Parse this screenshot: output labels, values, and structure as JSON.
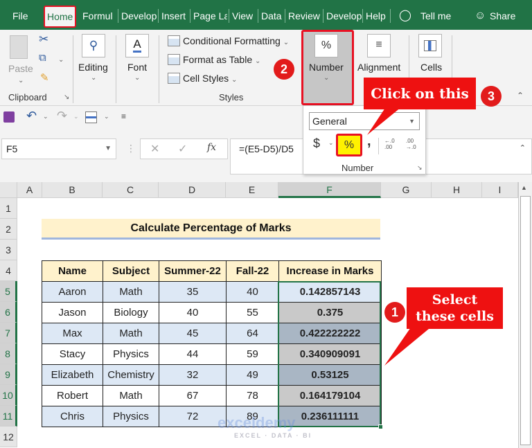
{
  "tabs": {
    "file": "File",
    "home": "Home",
    "formulas": "Formul",
    "developer1": "Develop",
    "insert": "Insert",
    "page_layout": "Page La",
    "view": "View",
    "data": "Data",
    "review": "Review",
    "developer2": "Develop",
    "help": "Help",
    "tell_me": "Tell me",
    "share": "Share"
  },
  "ribbon": {
    "paste": "Paste",
    "clipboard": "Clipboard",
    "editing": "Editing",
    "font": "Font",
    "conditional_formatting": "Conditional Formatting",
    "format_as_table": "Format as Table",
    "cell_styles": "Cell Styles",
    "styles": "Styles",
    "number": "Number",
    "alignment": "Alignment",
    "cells": "Cells",
    "number_glyph": "%"
  },
  "formula_bar": {
    "name_box": "F5",
    "formula": "=(E5-D5)/D5",
    "fx": "fx"
  },
  "number_popup": {
    "format": "General",
    "currency": "$",
    "percent": "%",
    "comma": ",",
    "inc_decimal": "←.0 .00",
    "dec_decimal": ".00 →.0",
    "label": "Number"
  },
  "grid": {
    "columns": [
      "A",
      "B",
      "C",
      "D",
      "E",
      "F",
      "G",
      "H",
      "I"
    ],
    "selected_column": "F",
    "rows": [
      "1",
      "2",
      "3",
      "4",
      "5",
      "6",
      "7",
      "8",
      "9",
      "10",
      "11",
      "12"
    ],
    "title": "Calculate Percentage of Marks",
    "headers": [
      "Name",
      "Subject",
      "Summer-22",
      "Fall-22",
      "Increase in Marks"
    ],
    "data": [
      [
        "Aaron",
        "Math",
        "35",
        "40",
        "0.142857143"
      ],
      [
        "Jason",
        "Biology",
        "40",
        "55",
        "0.375"
      ],
      [
        "Max",
        "Math",
        "45",
        "64",
        "0.422222222"
      ],
      [
        "Stacy",
        "Physics",
        "44",
        "59",
        "0.340909091"
      ],
      [
        "Elizabeth",
        "Chemistry",
        "32",
        "49",
        "0.53125"
      ],
      [
        "Robert",
        "Math",
        "67",
        "78",
        "0.164179104"
      ],
      [
        "Chris",
        "Physics",
        "72",
        "89",
        "0.236111111"
      ]
    ]
  },
  "annotations": {
    "step1_badge": "1",
    "step1_text_line1": "Select",
    "step1_text_line2": "these cells",
    "step2_badge": "2",
    "step3_badge": "3",
    "step3_text": "Click on this",
    "accent_red": "#ee1111"
  },
  "watermark": {
    "brand": "exceldemy",
    "tagline": "EXCEL · DATA · BI"
  },
  "colors": {
    "excel_green": "#217346",
    "header_fill": "#fff2cc",
    "row_band": "#dde8f5"
  }
}
